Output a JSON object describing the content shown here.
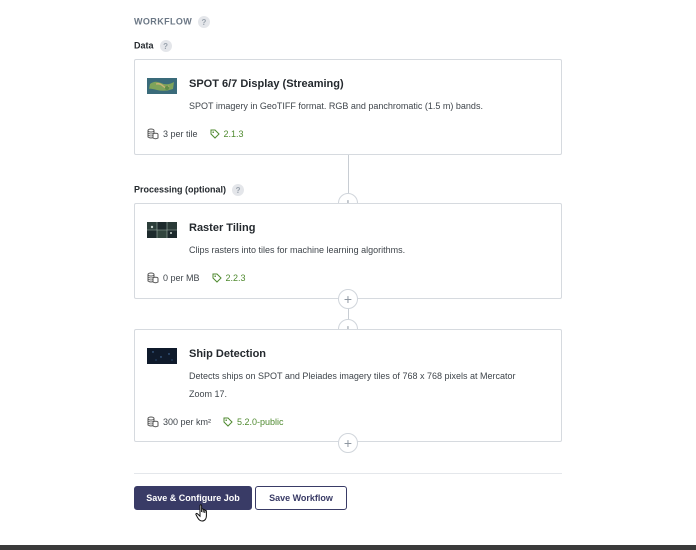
{
  "workflow": {
    "heading": "WORKFLOW",
    "help": "?"
  },
  "data_section": {
    "label": "Data",
    "help": "?"
  },
  "processing_section": {
    "label": "Processing (optional)",
    "help": "?"
  },
  "blocks": [
    {
      "title": "SPOT 6/7 Display (Streaming)",
      "description": "SPOT imagery in GeoTIFF format. RGB and panchromatic (1.5 m) bands.",
      "cost": "3 per tile",
      "version": "2.1.3",
      "thumbnail_icon": "satellite-scene-thumbnail"
    },
    {
      "title": "Raster Tiling",
      "description": "Clips rasters into tiles for machine learning algorithms.",
      "cost": "0 per MB",
      "version": "2.2.3",
      "thumbnail_icon": "raster-tiling-thumbnail"
    },
    {
      "title": "Ship Detection",
      "description": "Detects ships on SPOT and Pleiades imagery tiles of 768 x 768 pixels at Mercator Zoom 17.",
      "cost": "300 per km²",
      "version": "5.2.0-public",
      "thumbnail_icon": "ship-detection-thumbnail"
    }
  ],
  "add_block_symbol": "+",
  "buttons": {
    "primary": "Save & Configure Job",
    "secondary": "Save Workflow"
  },
  "colors": {
    "primary": "#393b66",
    "version_green": "#4f8a2f",
    "border": "#d6dadf"
  }
}
